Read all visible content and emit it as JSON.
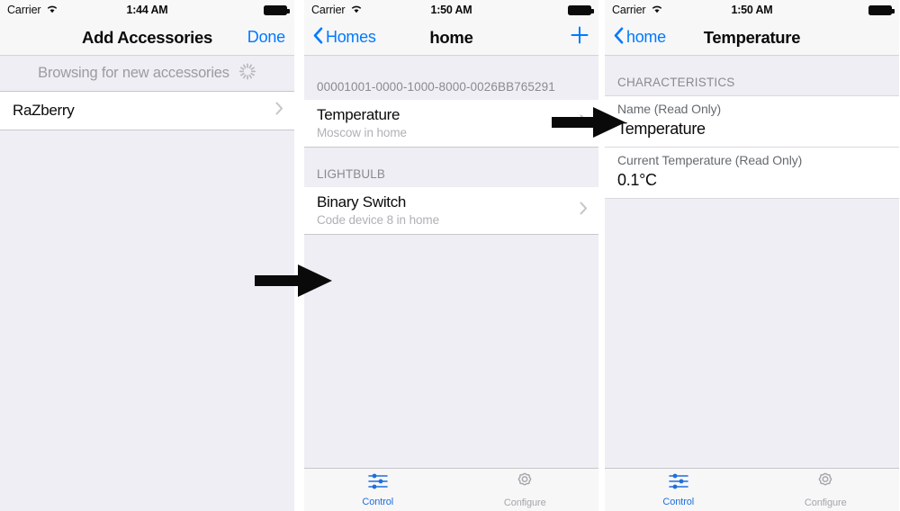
{
  "panels": [
    {
      "id": "add-accessories",
      "statusbar": {
        "carrier": "Carrier",
        "time": "1:44 AM",
        "wifi_icon": "wifi-icon",
        "battery_icon": "battery-icon"
      },
      "navbar": {
        "title": "Add Accessories",
        "right_label": "Done"
      },
      "browsing": {
        "text": "Browsing for new accessories",
        "spinner_icon": "activity-spinner-icon"
      },
      "rows": [
        {
          "title": "RaZberry",
          "accessory_icon": "chevron-right-icon"
        }
      ]
    },
    {
      "id": "home",
      "statusbar": {
        "carrier": "Carrier",
        "time": "1:50 AM",
        "wifi_icon": "wifi-icon",
        "battery_icon": "battery-icon"
      },
      "navbar": {
        "back_label": "Homes",
        "back_icon": "chevron-left-icon",
        "title": "home",
        "right_icon": "plus-icon"
      },
      "sections": [
        {
          "header": "00001001-0000-1000-8000-0026BB765291",
          "rows": [
            {
              "title": "Temperature",
              "subtitle": "Moscow in home",
              "accessory_icon": "chevron-right-icon"
            }
          ]
        },
        {
          "header": "LIGHTBULB",
          "rows": [
            {
              "title": "Binary Switch",
              "subtitle": "Code device 8 in home",
              "accessory_icon": "chevron-right-icon"
            }
          ]
        }
      ],
      "tabbar": [
        {
          "label": "Control",
          "icon": "sliders-icon",
          "state": "active"
        },
        {
          "label": "Configure",
          "icon": "gear-icon",
          "state": "inactive"
        }
      ]
    },
    {
      "id": "temperature",
      "statusbar": {
        "carrier": "Carrier",
        "time": "1:50 AM",
        "wifi_icon": "wifi-icon",
        "battery_icon": "battery-icon"
      },
      "navbar": {
        "back_label": "home",
        "back_icon": "chevron-left-icon",
        "title": "Temperature"
      },
      "section_header": "CHARACTERISTICS",
      "characteristics": [
        {
          "label": "Name (Read Only)",
          "value": "Temperature"
        },
        {
          "label": "Current Temperature (Read Only)",
          "value": "0.1°C"
        }
      ],
      "tabbar": [
        {
          "label": "Control",
          "icon": "sliders-icon",
          "state": "active"
        },
        {
          "label": "Configure",
          "icon": "gear-icon",
          "state": "inactive"
        }
      ]
    }
  ],
  "annotations": [
    {
      "name": "flow-arrow-1",
      "icon": "right-arrow-icon"
    },
    {
      "name": "flow-arrow-2",
      "icon": "right-arrow-icon"
    }
  ],
  "colors": {
    "accent_blue": "#007aff",
    "tab_active_blue": "#1e6fd9",
    "group_background": "#eeeef4",
    "cell_background": "#ffffff",
    "separator": "#c8c7cc",
    "secondary_text": "#8a8a90"
  }
}
